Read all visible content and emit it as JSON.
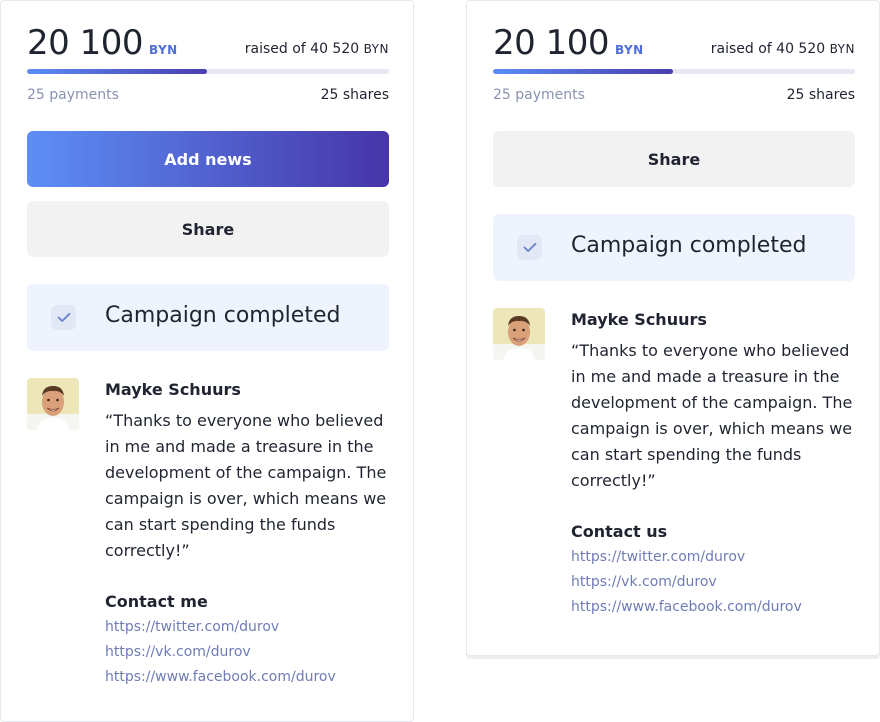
{
  "cards": [
    {
      "amount": "20 100",
      "currency": "BYN",
      "raised_prefix": "raised of 40 520",
      "raised_currency": "BYN",
      "progress": 0.496,
      "payments": "25 payments",
      "shares": "25 shares",
      "add_news_label": "Add news",
      "share_label": "Share",
      "status_label": "Campaign completed",
      "author_name": "Mayke Schuurs",
      "quote": "“Thanks to everyone who believed in me and made a treasure in the development of the campaign. The campaign is over, which means we can start spending the funds correctly!”",
      "contact_title": "Contact me",
      "links": [
        "https://twitter.com/durov",
        "https://vk.com/durov",
        "https://www.facebook.com/durov"
      ]
    },
    {
      "amount": "20 100",
      "currency": "BYN",
      "raised_prefix": "raised of 40 520",
      "raised_currency": "BYN",
      "progress": 0.496,
      "payments": "25 payments",
      "shares": "25 shares",
      "share_label": "Share",
      "status_label": "Campaign completed",
      "author_name": "Mayke Schuurs",
      "quote": "“Thanks to everyone who believed in me and made a treasure in the development of the campaign. The campaign is over, which means we can start spending the funds correctly!”",
      "contact_title": "Contact us",
      "links": [
        "https://twitter.com/durov",
        "https://vk.com/durov",
        "https://www.facebook.com/durov"
      ]
    }
  ],
  "colors": {
    "accent_start": "#5d8ff6",
    "accent_end": "#4635a8",
    "currency_blue": "#4f6fd8",
    "link": "#6f7cb5",
    "status_bg": "#eff3fd"
  },
  "icons": {
    "check": "check-icon",
    "avatar": "avatar"
  }
}
